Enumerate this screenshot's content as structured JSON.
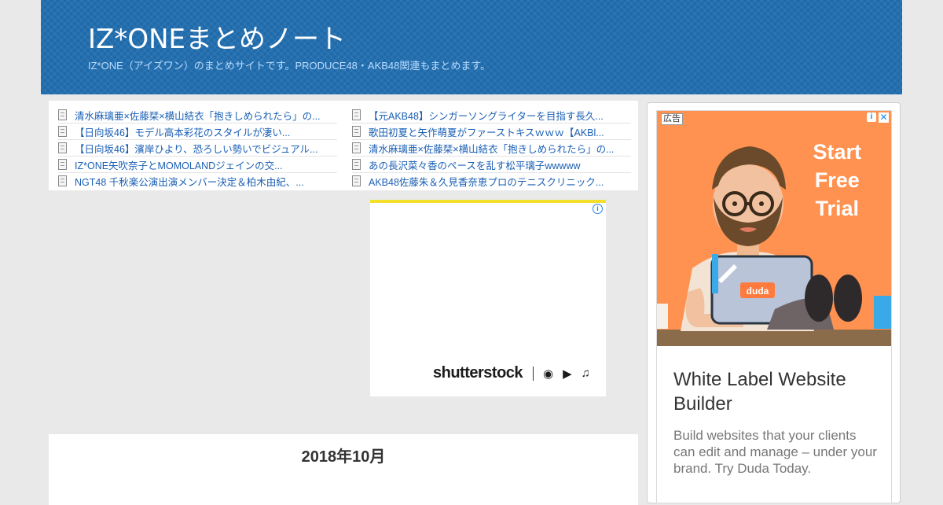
{
  "header": {
    "title": "IZ*ONEまとめノート",
    "description": "IZ*ONE（アイズワン）のまとめサイトです。PRODUCE48・AKB48関連もまとめます。"
  },
  "links": {
    "left": [
      "清水麻璃亜×佐藤栞×横山結衣「抱きしめられたら」の...",
      "【日向坂46】モデル高本彩花のスタイルが凄い...",
      "【日向坂46】濱岸ひより、恐ろしい勢いでビジュアル...",
      "IZ*ONE矢吹奈子とMOMOLANDジェインの交...",
      "NGT48 千秋楽公演出演メンバー決定＆柏木由紀、..."
    ],
    "right": [
      "【元AKB48】シンガーソングライターを目指す長久...",
      "歌田初夏と矢作萌夏がファーストキスｗｗｗ【AKBl...",
      "清水麻璃亜×佐藤栞×横山結衣「抱きしめられたら」の...",
      "あの長沢菜々香のペースを乱す松平璃子wwwww",
      "AKB48佐藤朱＆久見香奈恵プロのテニスクリニック..."
    ]
  },
  "mid_ad": {
    "brand": "shutterstock",
    "icons": [
      "camera-icon",
      "video-icon",
      "music-icon"
    ]
  },
  "archive": {
    "month_title": "2018年10月"
  },
  "side_ad": {
    "label": "広告",
    "cta_lines": [
      "Start",
      "Free",
      "Trial"
    ],
    "laptop_brand": "duda",
    "title": "White Label Website Builder",
    "body": "Build websites that your clients can edit and manage – under your brand. Try Duda Today.",
    "accent_color": "#ff9250"
  }
}
